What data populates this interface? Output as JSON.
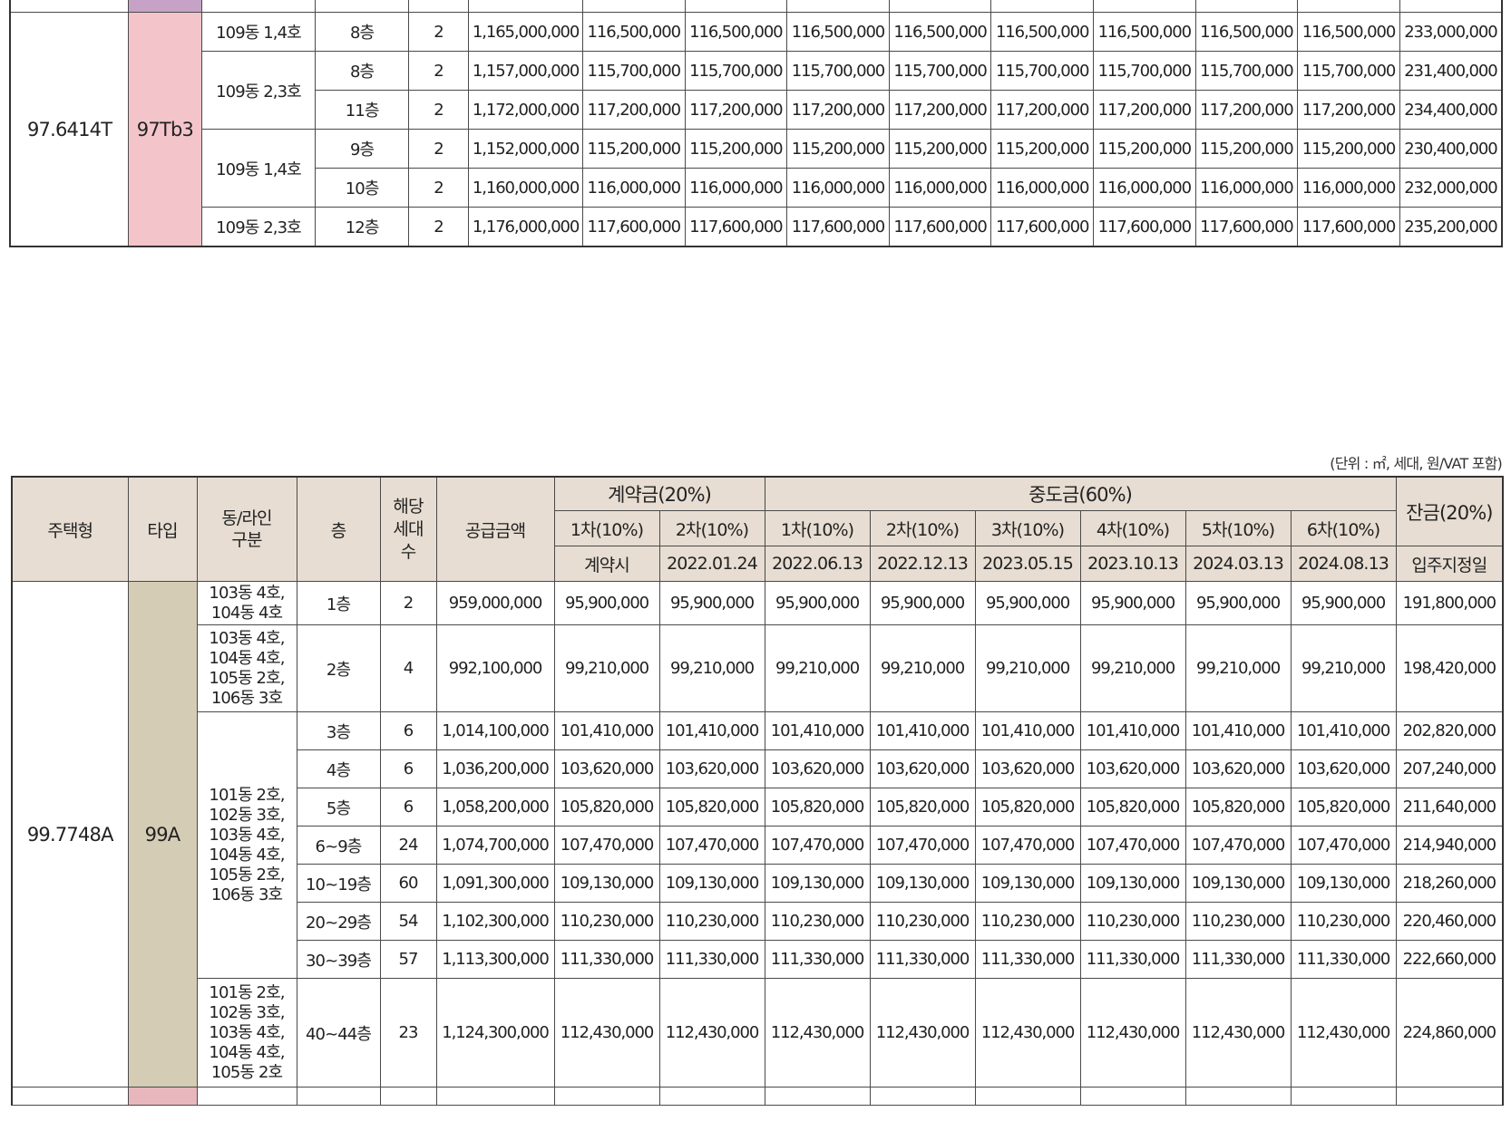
{
  "unit_note": "(단위 : ㎡, 세대, 원/VAT 포함)",
  "top_table": {
    "housing_type": "97.6414T",
    "type": "97Tb3",
    "rows": [
      {
        "dong": "109동 1,4호",
        "floor": "8층",
        "units": "2",
        "supply": "1,165,000,000",
        "c1": "116,500,000",
        "c2": "116,500,000",
        "m1": "116,500,000",
        "m2": "116,500,000",
        "m3": "116,500,000",
        "m4": "116,500,000",
        "m5": "116,500,000",
        "m6": "116,500,000",
        "balance": "233,000,000"
      },
      {
        "dong": "109동 2,3호",
        "floor": "8층",
        "units": "2",
        "supply": "1,157,000,000",
        "c1": "115,700,000",
        "c2": "115,700,000",
        "m1": "115,700,000",
        "m2": "115,700,000",
        "m3": "115,700,000",
        "m4": "115,700,000",
        "m5": "115,700,000",
        "m6": "115,700,000",
        "balance": "231,400,000"
      },
      {
        "floor": "11층",
        "units": "2",
        "supply": "1,172,000,000",
        "c1": "117,200,000",
        "c2": "117,200,000",
        "m1": "117,200,000",
        "m2": "117,200,000",
        "m3": "117,200,000",
        "m4": "117,200,000",
        "m5": "117,200,000",
        "m6": "117,200,000",
        "balance": "234,400,000"
      },
      {
        "dong": "109동 1,4호",
        "floor": "9층",
        "units": "2",
        "supply": "1,152,000,000",
        "c1": "115,200,000",
        "c2": "115,200,000",
        "m1": "115,200,000",
        "m2": "115,200,000",
        "m3": "115,200,000",
        "m4": "115,200,000",
        "m5": "115,200,000",
        "m6": "115,200,000",
        "balance": "230,400,000"
      },
      {
        "floor": "10층",
        "units": "2",
        "supply": "1,160,000,000",
        "c1": "116,000,000",
        "c2": "116,000,000",
        "m1": "116,000,000",
        "m2": "116,000,000",
        "m3": "116,000,000",
        "m4": "116,000,000",
        "m5": "116,000,000",
        "m6": "116,000,000",
        "balance": "232,000,000"
      },
      {
        "dong": "109동 2,3호",
        "floor": "12층",
        "units": "2",
        "supply": "1,176,000,000",
        "c1": "117,600,000",
        "c2": "117,600,000",
        "m1": "117,600,000",
        "m2": "117,600,000",
        "m3": "117,600,000",
        "m4": "117,600,000",
        "m5": "117,600,000",
        "m6": "117,600,000",
        "balance": "235,200,000"
      }
    ]
  },
  "header": {
    "housing_type": "주택형",
    "type": "타입",
    "dong_line": "동/라인 구분",
    "floor": "층",
    "units": "해당 세대 수",
    "supply": "공급금액",
    "contract": "계약금(20%)",
    "middle": "중도금(60%)",
    "balance": "잔금(20%)",
    "c1": "1차(10%)",
    "c2": "2차(10%)",
    "m1": "1차(10%)",
    "m2": "2차(10%)",
    "m3": "3차(10%)",
    "m4": "4차(10%)",
    "m5": "5차(10%)",
    "m6": "6차(10%)",
    "d_c1": "계약시",
    "d_c2": "2022.01.24",
    "d_m1": "2022.06.13",
    "d_m2": "2022.12.13",
    "d_m3": "2023.05.15",
    "d_m4": "2023.10.13",
    "d_m5": "2024.03.13",
    "d_m6": "2024.08.13",
    "d_bal": "입주지정일"
  },
  "bottom_table": {
    "housing_type": "99.7748A",
    "type": "99A",
    "dong_groups": {
      "g1": "103동 4호,\n104동 4호",
      "g2": "103동 4호,\n104동 4호,\n105동 2호,\n106동 3호",
      "g3": "101동 2호,\n102동 3호,\n103동 4호,\n104동 4호,\n105동 2호,\n106동 3호",
      "g4": "101동 2호,\n102동 3호,\n103동 4호,\n104동 4호,\n105동 2호"
    },
    "rows": [
      {
        "floor": "1층",
        "units": "2",
        "supply": "959,000,000",
        "c1": "95,900,000",
        "c2": "95,900,000",
        "m1": "95,900,000",
        "m2": "95,900,000",
        "m3": "95,900,000",
        "m4": "95,900,000",
        "m5": "95,900,000",
        "m6": "95,900,000",
        "balance": "191,800,000"
      },
      {
        "floor": "2층",
        "units": "4",
        "supply": "992,100,000",
        "c1": "99,210,000",
        "c2": "99,210,000",
        "m1": "99,210,000",
        "m2": "99,210,000",
        "m3": "99,210,000",
        "m4": "99,210,000",
        "m5": "99,210,000",
        "m6": "99,210,000",
        "balance": "198,420,000"
      },
      {
        "floor": "3층",
        "units": "6",
        "supply": "1,014,100,000",
        "c1": "101,410,000",
        "c2": "101,410,000",
        "m1": "101,410,000",
        "m2": "101,410,000",
        "m3": "101,410,000",
        "m4": "101,410,000",
        "m5": "101,410,000",
        "m6": "101,410,000",
        "balance": "202,820,000"
      },
      {
        "floor": "4층",
        "units": "6",
        "supply": "1,036,200,000",
        "c1": "103,620,000",
        "c2": "103,620,000",
        "m1": "103,620,000",
        "m2": "103,620,000",
        "m3": "103,620,000",
        "m4": "103,620,000",
        "m5": "103,620,000",
        "m6": "103,620,000",
        "balance": "207,240,000"
      },
      {
        "floor": "5층",
        "units": "6",
        "supply": "1,058,200,000",
        "c1": "105,820,000",
        "c2": "105,820,000",
        "m1": "105,820,000",
        "m2": "105,820,000",
        "m3": "105,820,000",
        "m4": "105,820,000",
        "m5": "105,820,000",
        "m6": "105,820,000",
        "balance": "211,640,000"
      },
      {
        "floor": "6~9층",
        "units": "24",
        "supply": "1,074,700,000",
        "c1": "107,470,000",
        "c2": "107,470,000",
        "m1": "107,470,000",
        "m2": "107,470,000",
        "m3": "107,470,000",
        "m4": "107,470,000",
        "m5": "107,470,000",
        "m6": "107,470,000",
        "balance": "214,940,000"
      },
      {
        "floor": "10~19층",
        "units": "60",
        "supply": "1,091,300,000",
        "c1": "109,130,000",
        "c2": "109,130,000",
        "m1": "109,130,000",
        "m2": "109,130,000",
        "m3": "109,130,000",
        "m4": "109,130,000",
        "m5": "109,130,000",
        "m6": "109,130,000",
        "balance": "218,260,000"
      },
      {
        "floor": "20~29층",
        "units": "54",
        "supply": "1,102,300,000",
        "c1": "110,230,000",
        "c2": "110,230,000",
        "m1": "110,230,000",
        "m2": "110,230,000",
        "m3": "110,230,000",
        "m4": "110,230,000",
        "m5": "110,230,000",
        "m6": "110,230,000",
        "balance": "220,460,000"
      },
      {
        "floor": "30~39층",
        "units": "57",
        "supply": "1,113,300,000",
        "c1": "111,330,000",
        "c2": "111,330,000",
        "m1": "111,330,000",
        "m2": "111,330,000",
        "m3": "111,330,000",
        "m4": "111,330,000",
        "m5": "111,330,000",
        "m6": "111,330,000",
        "balance": "222,660,000"
      },
      {
        "floor": "40~44층",
        "units": "23",
        "supply": "1,124,300,000",
        "c1": "112,430,000",
        "c2": "112,430,000",
        "m1": "112,430,000",
        "m2": "112,430,000",
        "m3": "112,430,000",
        "m4": "112,430,000",
        "m5": "112,430,000",
        "m6": "112,430,000",
        "balance": "224,860,000"
      }
    ]
  }
}
